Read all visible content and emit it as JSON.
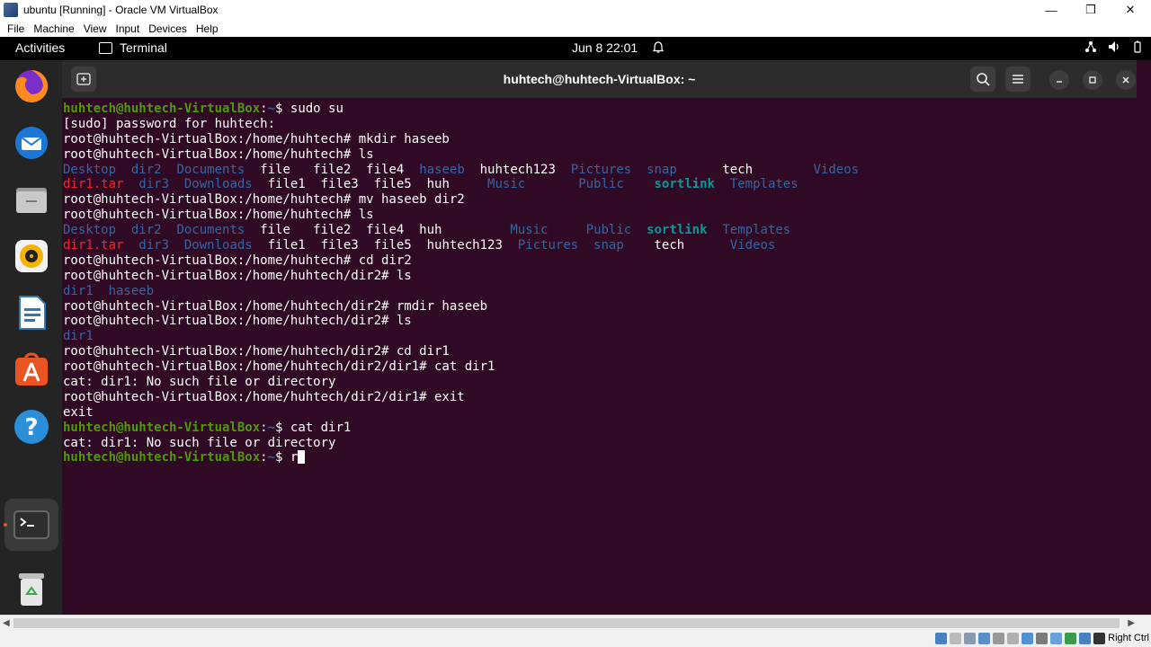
{
  "host_window": {
    "title": "ubuntu [Running] - Oracle VM VirtualBox",
    "controls": {
      "minimize": "—",
      "maximize": "❐",
      "close": "✕"
    }
  },
  "vb_menu": [
    "File",
    "Machine",
    "View",
    "Input",
    "Devices",
    "Help"
  ],
  "gnome_topbar": {
    "activities": "Activities",
    "app_name": "Terminal",
    "clock": "Jun 8  22:01"
  },
  "dock": {
    "items": [
      "firefox-icon",
      "thunderbird-icon",
      "files-icon",
      "rhythmbox-icon",
      "libreoffice-writer-icon",
      "app-center-icon",
      "help-icon",
      "terminal-icon",
      "trash-icon"
    ]
  },
  "terminal": {
    "title": "huhtech@huhtech-VirtualBox: ~",
    "lines": [
      [
        {
          "t": "huhtech@huhtech-VirtualBox",
          "c": "pg"
        },
        {
          "t": ":",
          "c": ""
        },
        {
          "t": "~",
          "c": "pb"
        },
        {
          "t": "$ sudo su",
          "c": ""
        }
      ],
      [
        {
          "t": "[sudo] password for huhtech:",
          "c": ""
        }
      ],
      [
        {
          "t": "root@huhtech-VirtualBox:/home/huhtech# mkdir haseeb",
          "c": ""
        }
      ],
      [
        {
          "t": "root@huhtech-VirtualBox:/home/huhtech# ls",
          "c": ""
        }
      ],
      [
        {
          "t": "Desktop",
          "c": "dir"
        },
        {
          "t": "  ",
          "c": ""
        },
        {
          "t": "dir2",
          "c": "dir"
        },
        {
          "t": "  ",
          "c": ""
        },
        {
          "t": "Documents",
          "c": "dir"
        },
        {
          "t": "  file   file2  file4  ",
          "c": ""
        },
        {
          "t": "haseeb",
          "c": "dir"
        },
        {
          "t": "  huhtech123  ",
          "c": ""
        },
        {
          "t": "Pictures",
          "c": "dir"
        },
        {
          "t": "  ",
          "c": ""
        },
        {
          "t": "snap",
          "c": "dir"
        },
        {
          "t": "      tech        ",
          "c": ""
        },
        {
          "t": "Videos",
          "c": "dir"
        }
      ],
      [
        {
          "t": "dir1.tar",
          "c": "arc"
        },
        {
          "t": "  ",
          "c": ""
        },
        {
          "t": "dir3",
          "c": "dir"
        },
        {
          "t": "  ",
          "c": ""
        },
        {
          "t": "Downloads",
          "c": "dir"
        },
        {
          "t": "  file1  file3  file5  huh     ",
          "c": ""
        },
        {
          "t": "Music",
          "c": "dir"
        },
        {
          "t": "       ",
          "c": ""
        },
        {
          "t": "Public",
          "c": "dir"
        },
        {
          "t": "    ",
          "c": ""
        },
        {
          "t": "sortlink",
          "c": "lnk"
        },
        {
          "t": "  ",
          "c": ""
        },
        {
          "t": "Templates",
          "c": "dir"
        }
      ],
      [
        {
          "t": "root@huhtech-VirtualBox:/home/huhtech# mv haseeb dir2",
          "c": ""
        }
      ],
      [
        {
          "t": "root@huhtech-VirtualBox:/home/huhtech# ls",
          "c": ""
        }
      ],
      [
        {
          "t": "Desktop",
          "c": "dir"
        },
        {
          "t": "  ",
          "c": ""
        },
        {
          "t": "dir2",
          "c": "dir"
        },
        {
          "t": "  ",
          "c": ""
        },
        {
          "t": "Documents",
          "c": "dir"
        },
        {
          "t": "  file   file2  file4  huh         ",
          "c": ""
        },
        {
          "t": "Music",
          "c": "dir"
        },
        {
          "t": "     ",
          "c": ""
        },
        {
          "t": "Public",
          "c": "dir"
        },
        {
          "t": "  ",
          "c": ""
        },
        {
          "t": "sortlink",
          "c": "lnk"
        },
        {
          "t": "  ",
          "c": ""
        },
        {
          "t": "Templates",
          "c": "dir"
        }
      ],
      [
        {
          "t": "dir1.tar",
          "c": "arc"
        },
        {
          "t": "  ",
          "c": ""
        },
        {
          "t": "dir3",
          "c": "dir"
        },
        {
          "t": "  ",
          "c": ""
        },
        {
          "t": "Downloads",
          "c": "dir"
        },
        {
          "t": "  file1  file3  file5  huhtech123  ",
          "c": ""
        },
        {
          "t": "Pictures",
          "c": "dir"
        },
        {
          "t": "  ",
          "c": ""
        },
        {
          "t": "snap",
          "c": "dir"
        },
        {
          "t": "    tech      ",
          "c": ""
        },
        {
          "t": "Videos",
          "c": "dir"
        }
      ],
      [
        {
          "t": "root@huhtech-VirtualBox:/home/huhtech# cd dir2",
          "c": ""
        }
      ],
      [
        {
          "t": "root@huhtech-VirtualBox:/home/huhtech/dir2# ls",
          "c": ""
        }
      ],
      [
        {
          "t": "dir1",
          "c": "dir"
        },
        {
          "t": "  ",
          "c": ""
        },
        {
          "t": "haseeb",
          "c": "dir"
        }
      ],
      [
        {
          "t": "root@huhtech-VirtualBox:/home/huhtech/dir2# rmdir haseeb",
          "c": ""
        }
      ],
      [
        {
          "t": "root@huhtech-VirtualBox:/home/huhtech/dir2# ls",
          "c": ""
        }
      ],
      [
        {
          "t": "dir1",
          "c": "dir"
        }
      ],
      [
        {
          "t": "root@huhtech-VirtualBox:/home/huhtech/dir2# cd dir1",
          "c": ""
        }
      ],
      [
        {
          "t": "root@huhtech-VirtualBox:/home/huhtech/dir2/dir1# cat dir1",
          "c": ""
        }
      ],
      [
        {
          "t": "cat: dir1: No such file or directory",
          "c": ""
        }
      ],
      [
        {
          "t": "root@huhtech-VirtualBox:/home/huhtech/dir2/dir1# exit",
          "c": ""
        }
      ],
      [
        {
          "t": "exit",
          "c": ""
        }
      ],
      [
        {
          "t": "huhtech@huhtech-VirtualBox",
          "c": "pg"
        },
        {
          "t": ":",
          "c": ""
        },
        {
          "t": "~",
          "c": "pb"
        },
        {
          "t": "$ cat dir1",
          "c": ""
        }
      ],
      [
        {
          "t": "cat: dir1: No such file or directory",
          "c": ""
        }
      ],
      [
        {
          "t": "huhtech@huhtech-VirtualBox",
          "c": "pg"
        },
        {
          "t": ":",
          "c": ""
        },
        {
          "t": "~",
          "c": "pb"
        },
        {
          "t": "$ r",
          "c": ""
        }
      ]
    ]
  },
  "status_bar": {
    "host_key": "Right Ctrl"
  },
  "colors": {
    "terminal_bg": "#300a24",
    "prompt_green": "#4e9a06",
    "dir_blue": "#3465a4",
    "archive_red": "#ef2929",
    "link_cyan": "#06989a"
  }
}
